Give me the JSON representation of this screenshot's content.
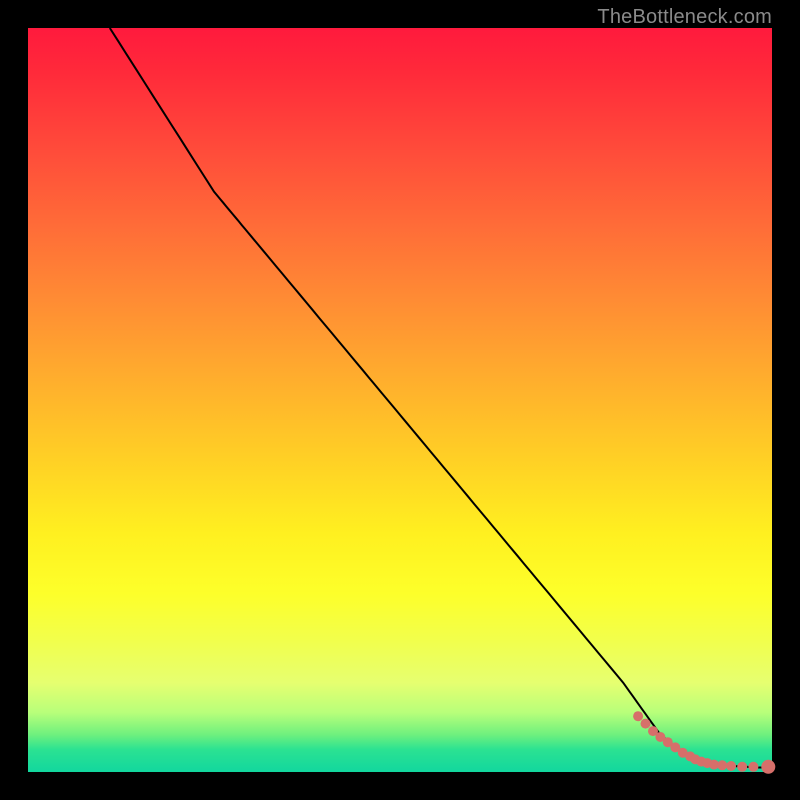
{
  "watermark": "TheBottleneck.com",
  "chart_data": {
    "type": "line",
    "title": "",
    "xlabel": "",
    "ylabel": "",
    "xlim": [
      0,
      100
    ],
    "ylim": [
      0,
      100
    ],
    "series": [
      {
        "name": "black-curve",
        "color": "#000000",
        "x": [
          11,
          25,
          30,
          40,
          50,
          60,
          70,
          80,
          85,
          88,
          92,
          95,
          98,
          100
        ],
        "y": [
          100,
          78,
          72,
          60,
          48,
          36,
          24,
          12,
          5,
          2.5,
          1.2,
          0.8,
          0.6,
          0.6
        ]
      }
    ],
    "points": [
      {
        "name": "scatter-cluster",
        "color": "#d66f6a",
        "r_small": 5,
        "r_large": 7,
        "xy": [
          [
            82,
            7.5
          ],
          [
            83,
            6.5
          ],
          [
            84,
            5.5
          ],
          [
            85,
            4.7
          ],
          [
            86,
            4.0
          ],
          [
            87,
            3.3
          ],
          [
            88,
            2.6
          ],
          [
            89,
            2.1
          ],
          [
            89.7,
            1.7
          ],
          [
            90.5,
            1.4
          ],
          [
            91.3,
            1.2
          ],
          [
            92.2,
            1.0
          ],
          [
            93.3,
            0.9
          ],
          [
            94.5,
            0.8
          ],
          [
            96.0,
            0.7
          ],
          [
            97.5,
            0.7
          ],
          [
            99.5,
            0.7
          ]
        ]
      }
    ],
    "colors": {
      "gradient_top": "#ff1a3d",
      "gradient_mid": "#ffd025",
      "gradient_bottom": "#12d79e",
      "border": "#000000"
    }
  }
}
